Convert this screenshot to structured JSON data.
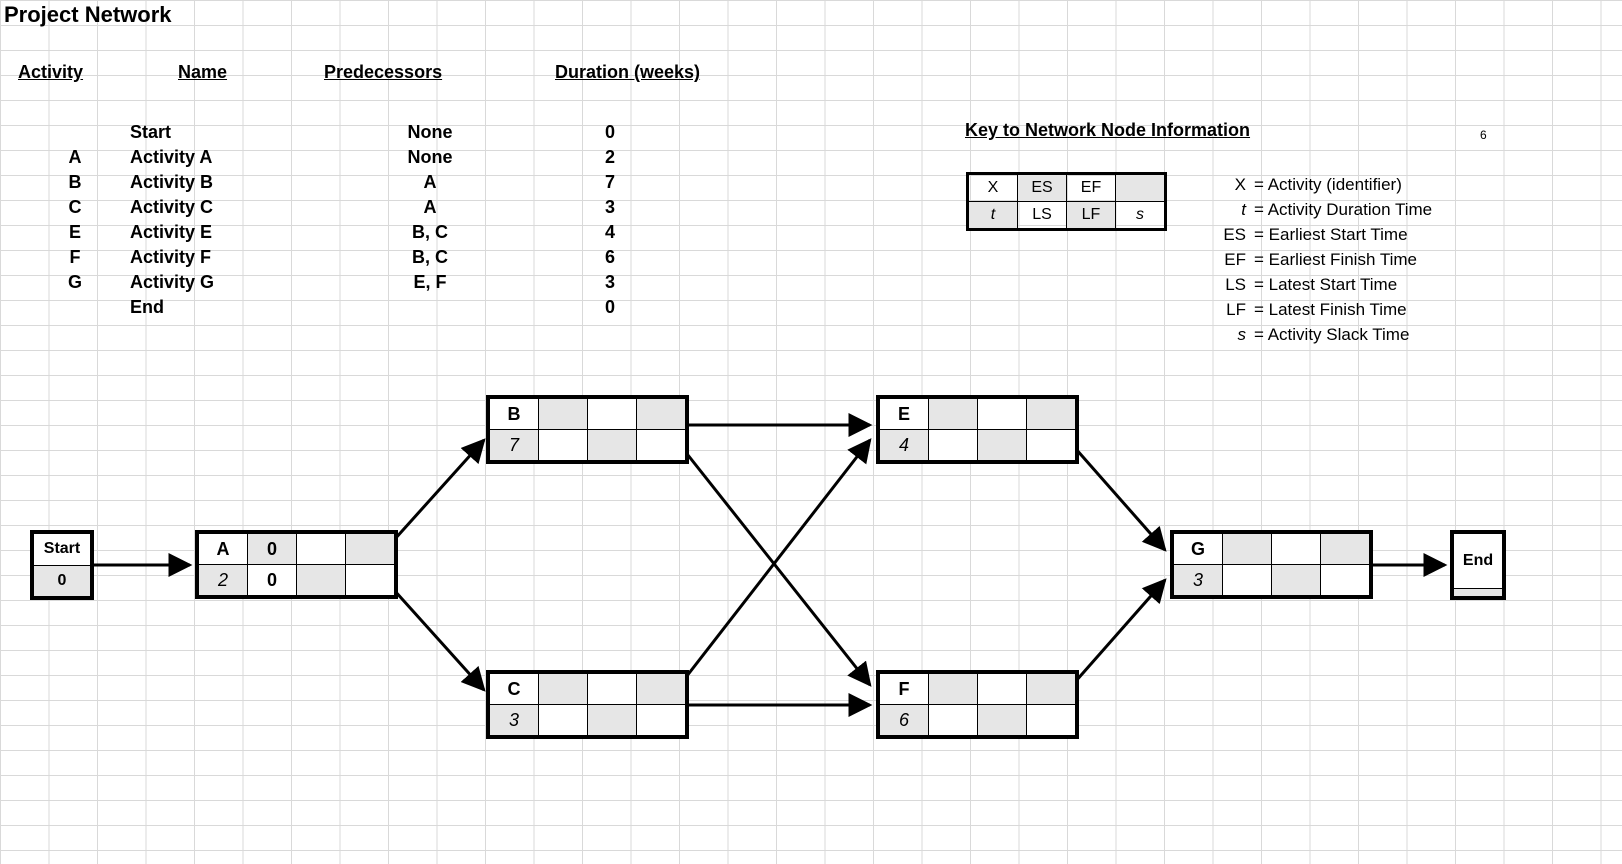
{
  "title": "Project Network",
  "columns": {
    "activity": "Activity",
    "name": "Name",
    "predecessors": "Predecessors",
    "duration": "Duration (weeks)"
  },
  "rows": [
    {
      "activity": "",
      "name": "Start",
      "predecessors": "None",
      "duration": "0"
    },
    {
      "activity": "A",
      "name": "Activity A",
      "predecessors": "None",
      "duration": "2"
    },
    {
      "activity": "B",
      "name": "Activity B",
      "predecessors": "A",
      "duration": "7"
    },
    {
      "activity": "C",
      "name": "Activity C",
      "predecessors": "A",
      "duration": "3"
    },
    {
      "activity": "E",
      "name": "Activity E",
      "predecessors": "B, C",
      "duration": "4"
    },
    {
      "activity": "F",
      "name": "Activity F",
      "predecessors": "B, C",
      "duration": "6"
    },
    {
      "activity": "G",
      "name": "Activity G",
      "predecessors": "E, F",
      "duration": "3"
    },
    {
      "activity": "",
      "name": "End",
      "predecessors": "",
      "duration": "0"
    }
  ],
  "pageNumber": "6",
  "key": {
    "title": "Key to Network Node Information",
    "cells": {
      "X": "X",
      "ES": "ES",
      "EF": "EF",
      "t": "t",
      "LS": "LS",
      "LF": "LF",
      "s": "s"
    },
    "legend": [
      {
        "sym": "X",
        "text": "= Activity (identifier)",
        "italic": false
      },
      {
        "sym": "t",
        "text": "= Activity Duration Time",
        "italic": true
      },
      {
        "sym": "ES",
        "text": "= Earliest Start Time",
        "italic": false
      },
      {
        "sym": "EF",
        "text": "= Earliest Finish Time",
        "italic": false
      },
      {
        "sym": "LS",
        "text": "= Latest Start Time",
        "italic": false
      },
      {
        "sym": "LF",
        "text": "= Latest Finish Time",
        "italic": false
      },
      {
        "sym": "s",
        "text": "= Activity Slack Time",
        "italic": true
      }
    ]
  },
  "network": {
    "start": {
      "label": "Start",
      "value": "0"
    },
    "end": {
      "label": "End"
    },
    "nodes": {
      "A": {
        "id": "A",
        "t": "2",
        "ES": "0",
        "EF": "",
        "LS": "0",
        "LF": "",
        "s": ""
      },
      "B": {
        "id": "B",
        "t": "7",
        "ES": "",
        "EF": "",
        "LS": "",
        "LF": "",
        "s": ""
      },
      "C": {
        "id": "C",
        "t": "3",
        "ES": "",
        "EF": "",
        "LS": "",
        "LF": "",
        "s": ""
      },
      "E": {
        "id": "E",
        "t": "4",
        "ES": "",
        "EF": "",
        "LS": "",
        "LF": "",
        "s": ""
      },
      "F": {
        "id": "F",
        "t": "6",
        "ES": "",
        "EF": "",
        "LS": "",
        "LF": "",
        "s": ""
      },
      "G": {
        "id": "G",
        "t": "3",
        "ES": "",
        "EF": "",
        "LS": "",
        "LF": "",
        "s": ""
      }
    }
  }
}
